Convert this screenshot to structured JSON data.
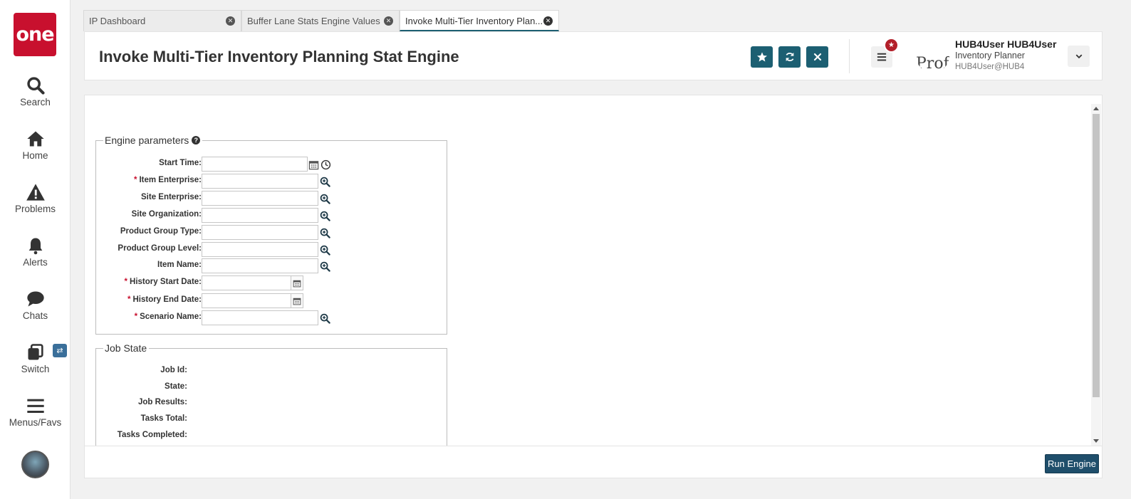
{
  "nav": {
    "logo": "one",
    "items": [
      {
        "label": "Search",
        "icon": "search-icon"
      },
      {
        "label": "Home",
        "icon": "home-icon"
      },
      {
        "label": "Problems",
        "icon": "warning-icon"
      },
      {
        "label": "Alerts",
        "icon": "bell-icon"
      },
      {
        "label": "Chats",
        "icon": "chat-icon"
      },
      {
        "label": "Switch",
        "icon": "switch-icon"
      },
      {
        "label": "Menus/Favs",
        "icon": "menu-icon"
      }
    ]
  },
  "tabs": [
    {
      "label": "IP Dashboard",
      "active": false
    },
    {
      "label": "Buffer Lane Stats Engine Values",
      "active": false
    },
    {
      "label": "Invoke Multi-Tier Inventory Plan...",
      "active": true
    }
  ],
  "header": {
    "title": "Invoke Multi-Tier Inventory Planning Stat Engine",
    "user_name": "HUB4User HUB4User",
    "user_role": "Inventory Planner",
    "user_email": "HUB4User@HUB4",
    "profile_image_text": "Prof"
  },
  "engine_params": {
    "legend": "Engine parameters",
    "fields": [
      {
        "label": "Start Time:",
        "required": false,
        "value": ""
      },
      {
        "label": "Item Enterprise:",
        "required": true,
        "value": ""
      },
      {
        "label": "Site Enterprise:",
        "required": false,
        "value": ""
      },
      {
        "label": "Site Organization:",
        "required": false,
        "value": ""
      },
      {
        "label": "Product Group Type:",
        "required": false,
        "value": ""
      },
      {
        "label": "Product Group Level:",
        "required": false,
        "value": ""
      },
      {
        "label": "Item Name:",
        "required": false,
        "value": ""
      },
      {
        "label": "History Start Date:",
        "required": true,
        "value": ""
      },
      {
        "label": "History End Date:",
        "required": true,
        "value": ""
      },
      {
        "label": "Scenario Name:",
        "required": true,
        "value": ""
      }
    ],
    "required_marker": "*"
  },
  "job_state": {
    "legend": "Job State",
    "fields": [
      {
        "label": "Job Id:",
        "value": ""
      },
      {
        "label": "State:",
        "value": ""
      },
      {
        "label": "Job Results:",
        "value": ""
      },
      {
        "label": "Tasks Total:",
        "value": ""
      },
      {
        "label": "Tasks Completed:",
        "value": ""
      }
    ]
  },
  "footer": {
    "run_label": "Run Engine"
  },
  "colors": {
    "brand_red": "#c8102e",
    "teal": "#1c5f72",
    "run_button": "#1f4e6b"
  }
}
